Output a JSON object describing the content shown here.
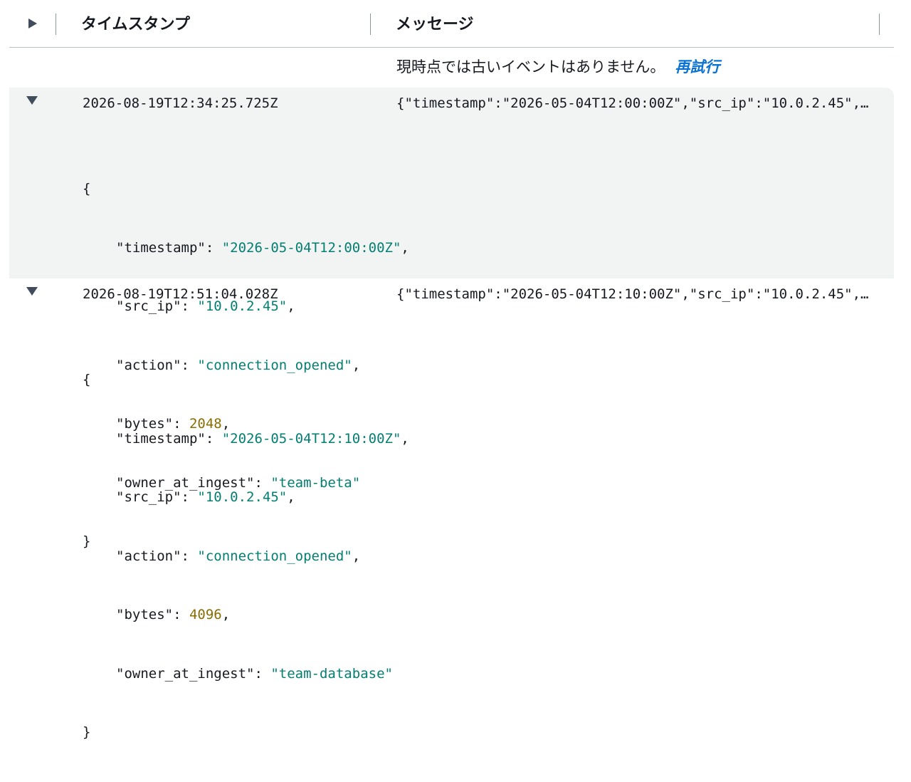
{
  "table": {
    "columns": [
      "タイムスタンプ",
      "メッセージ"
    ]
  },
  "status": {
    "message": "現時点では古いイベントはありません。",
    "retry_label": "再試行"
  },
  "events": [
    {
      "timestamp": "2026-08-19T12:34:25.725Z",
      "message": "{\"timestamp\":\"2026-05-04T12:00:00Z\",\"src_ip\":\"10.0.2.45\",\"action\":\"connection_opened\",\"bytes\":2048,\"owner_at_ingest\":\"team-beta\"}",
      "json_open": "{",
      "json_close": "}",
      "fields": [
        {
          "key": "\"timestamp\"",
          "value": "\"2026-05-04T12:00:00Z\"",
          "type": "string",
          "trail": ","
        },
        {
          "key": "\"src_ip\"",
          "value": "\"10.0.2.45\"",
          "type": "string",
          "trail": ","
        },
        {
          "key": "\"action\"",
          "value": "\"connection_opened\"",
          "type": "string",
          "trail": ","
        },
        {
          "key": "\"bytes\"",
          "value": "2048",
          "type": "number",
          "trail": ","
        },
        {
          "key": "\"owner_at_ingest\"",
          "value": "\"team-beta\"",
          "type": "string",
          "trail": ""
        }
      ]
    },
    {
      "timestamp": "2026-08-19T12:51:04.028Z",
      "message": "{\"timestamp\":\"2026-05-04T12:10:00Z\",\"src_ip\":\"10.0.2.45\",\"action\":\"connection_opened\",\"bytes\":4096,\"owner_at_ingest\":\"team-database\"}",
      "json_open": "{",
      "json_close": "}",
      "fields": [
        {
          "key": "\"timestamp\"",
          "value": "\"2026-05-04T12:10:00Z\"",
          "type": "string",
          "trail": ","
        },
        {
          "key": "\"src_ip\"",
          "value": "\"10.0.2.45\"",
          "type": "string",
          "trail": ","
        },
        {
          "key": "\"action\"",
          "value": "\"connection_opened\"",
          "type": "string",
          "trail": ","
        },
        {
          "key": "\"bytes\"",
          "value": "4096",
          "type": "number",
          "trail": ","
        },
        {
          "key": "\"owner_at_ingest\"",
          "value": "\"team-database\"",
          "type": "string",
          "trail": ""
        }
      ]
    }
  ]
}
